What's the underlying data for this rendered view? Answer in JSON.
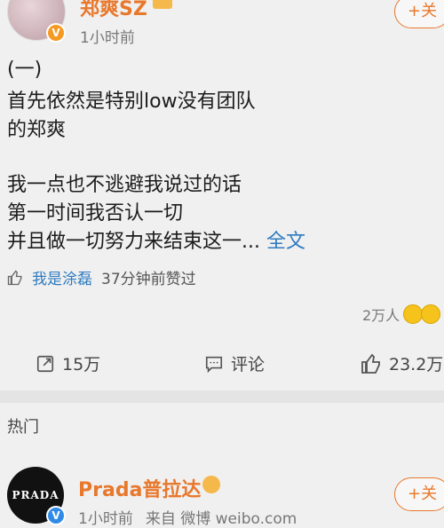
{
  "post": {
    "author": "郑爽SZ",
    "time": "1小时前",
    "follow_label": "+关",
    "lines": [
      "(一)",
      "首先依然是特别low没有团队",
      "的郑爽",
      "我一点也不逃避我说过的话",
      "第一时间我否认一切",
      "并且做一切努力来结束这一..."
    ],
    "full_text_link": "全文",
    "liked_by": "我是涂磊",
    "liked_text": "37分钟前赞过",
    "reactions_count": "2万人",
    "actions": {
      "repost": "15万",
      "comment": "评论",
      "like": "23.2万"
    }
  },
  "section_title": "热门",
  "second_post": {
    "author": "Prada普拉达",
    "logo_text": "PRADA",
    "time": "1小时前",
    "source": "来自 微博 weibo.com",
    "follow_label": "+关"
  },
  "colors": {
    "author": "#e8782c",
    "link": "#2e7bc0",
    "background": "#f0f0f0"
  },
  "icons": [
    "verified-badge-icon",
    "thumbs-up-icon",
    "repost-icon",
    "comment-icon",
    "like-icon"
  ]
}
